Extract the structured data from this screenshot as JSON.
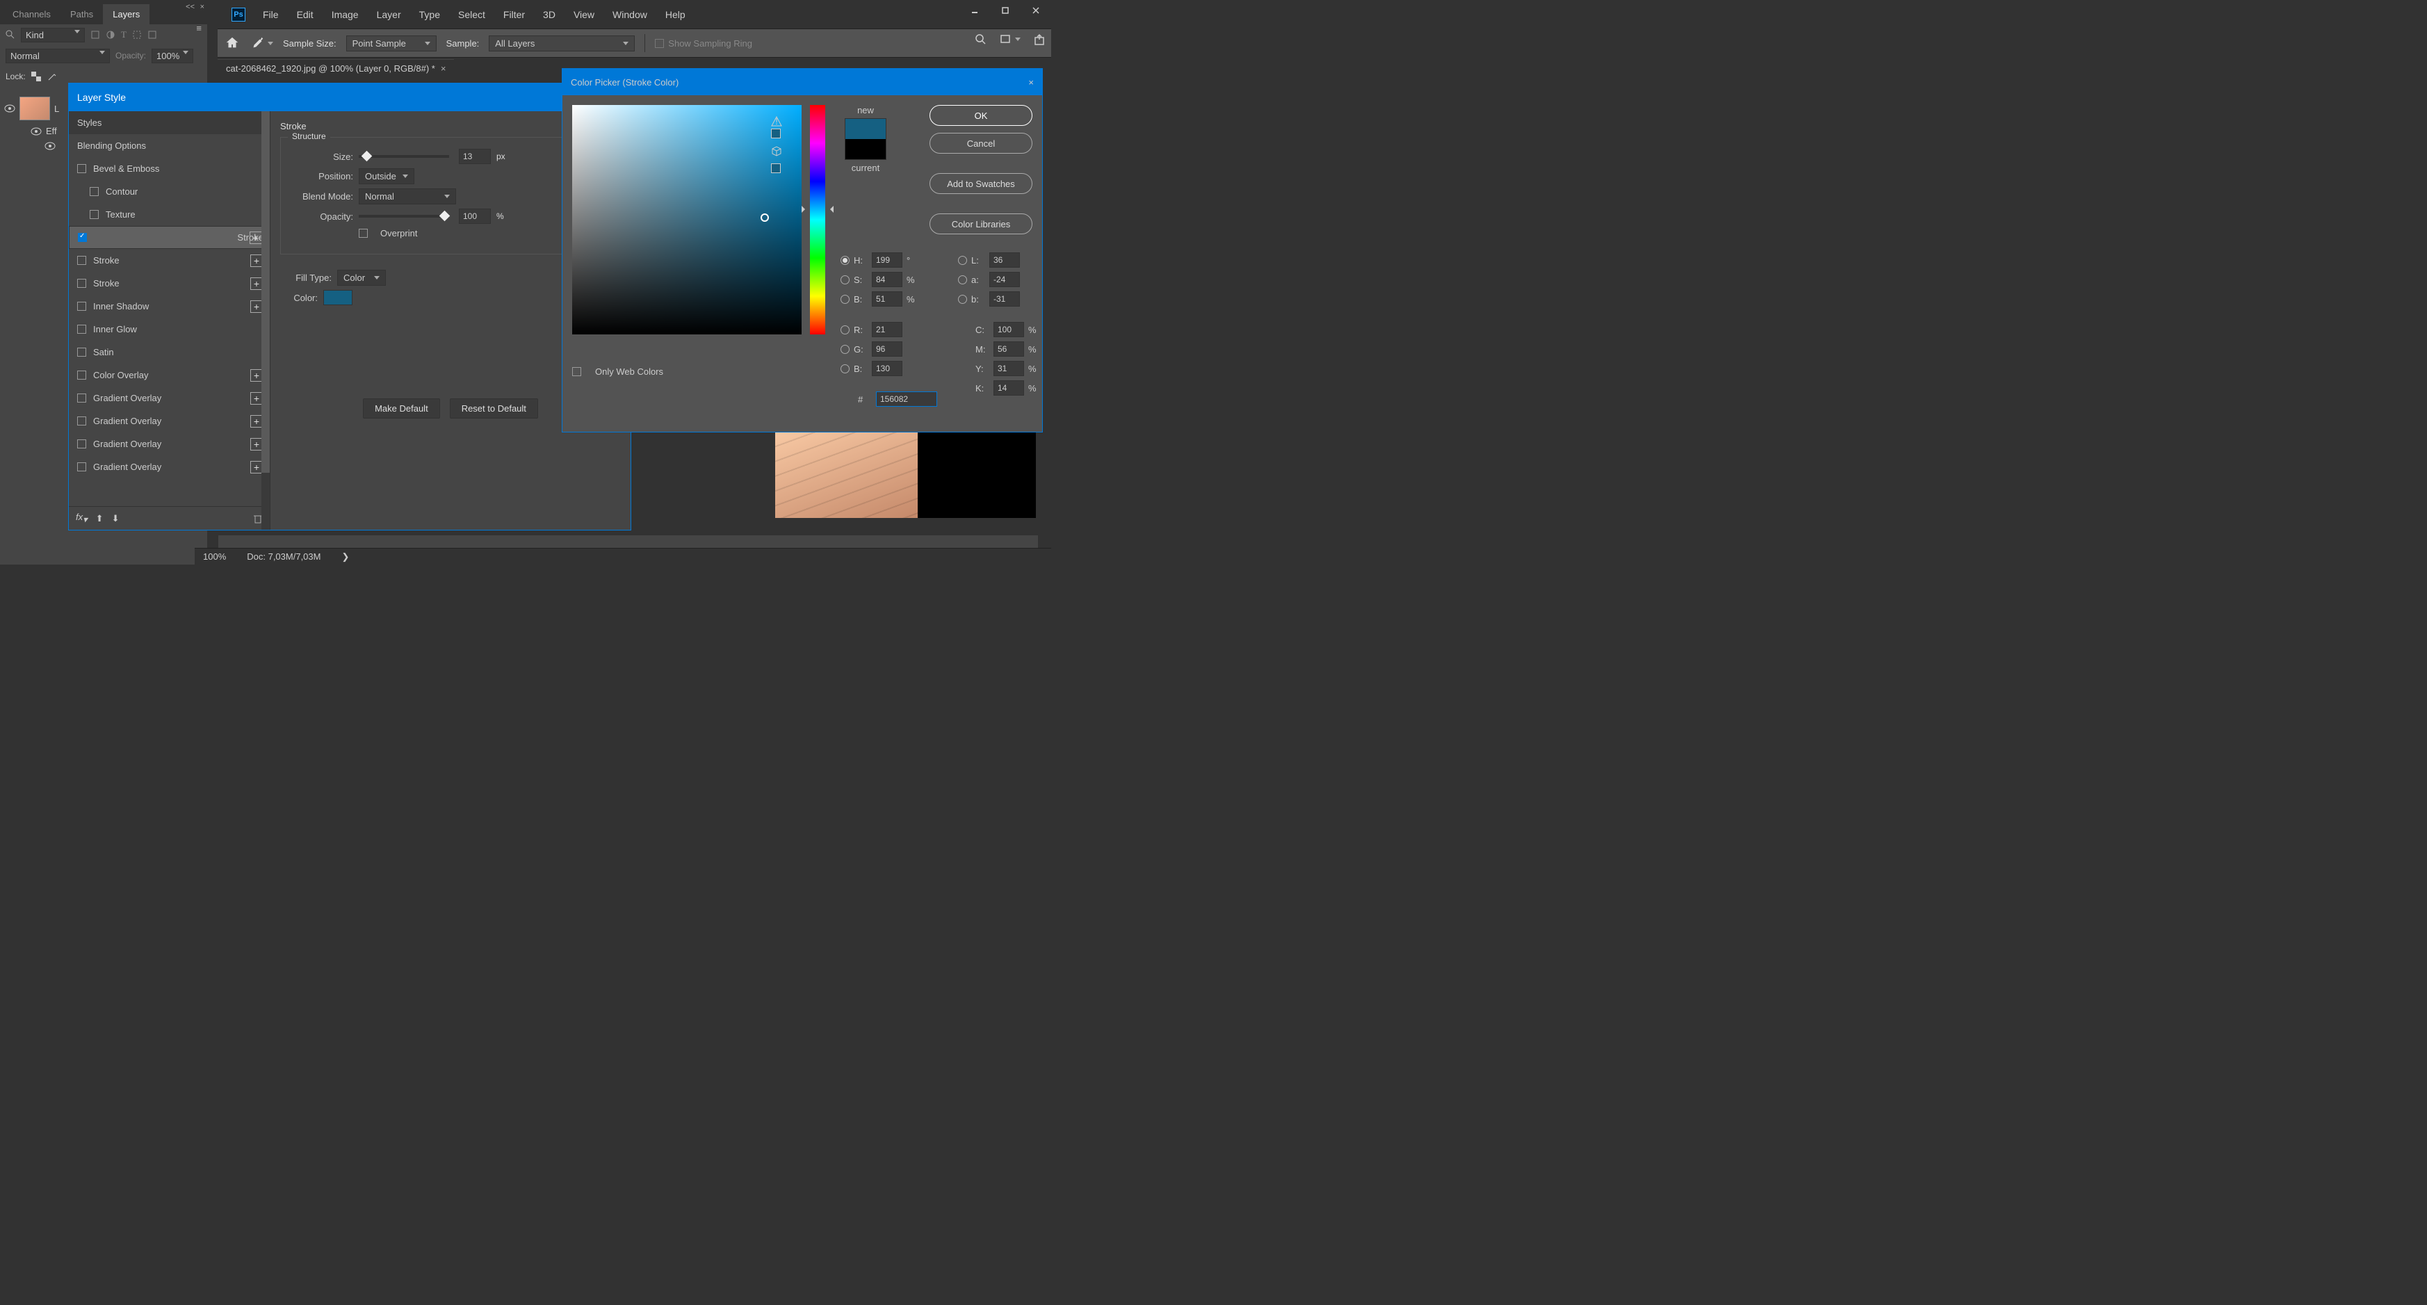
{
  "app": {
    "name": "Ps"
  },
  "menu": [
    "File",
    "Edit",
    "Image",
    "Layer",
    "Type",
    "Select",
    "Filter",
    "3D",
    "View",
    "Window",
    "Help"
  ],
  "toolbar": {
    "sample_size_label": "Sample Size:",
    "sample_size_value": "Point Sample",
    "sample_label": "Sample:",
    "sample_value": "All Layers",
    "show_ring": "Show Sampling Ring"
  },
  "document": {
    "tab": "cat-2068462_1920.jpg @ 100% (Layer 0, RGB/8#) *"
  },
  "panels": {
    "tabs": [
      "Channels",
      "Paths",
      "Layers"
    ],
    "kind_filter": "Kind",
    "blend_mode": "Normal",
    "opacity_label": "Opacity:",
    "opacity_value": "100%",
    "lock_label": "Lock:",
    "layer0": "L",
    "effects": "Eff",
    "sub": ""
  },
  "layerstyle": {
    "title": "Layer Style",
    "styles": "Styles",
    "blending": "Blending Options",
    "rows": [
      {
        "label": "Bevel & Emboss",
        "chk": false,
        "plus": false,
        "indent": 0
      },
      {
        "label": "Contour",
        "chk": false,
        "plus": false,
        "indent": 1
      },
      {
        "label": "Texture",
        "chk": false,
        "plus": false,
        "indent": 1
      },
      {
        "label": "Stroke",
        "chk": true,
        "plus": true,
        "indent": 0,
        "sel": true
      },
      {
        "label": "Stroke",
        "chk": false,
        "plus": true,
        "indent": 0
      },
      {
        "label": "Stroke",
        "chk": false,
        "plus": true,
        "indent": 0
      },
      {
        "label": "Inner Shadow",
        "chk": false,
        "plus": true,
        "indent": 0
      },
      {
        "label": "Inner Glow",
        "chk": false,
        "plus": false,
        "indent": 0
      },
      {
        "label": "Satin",
        "chk": false,
        "plus": false,
        "indent": 0
      },
      {
        "label": "Color Overlay",
        "chk": false,
        "plus": true,
        "indent": 0
      },
      {
        "label": "Gradient Overlay",
        "chk": false,
        "plus": true,
        "indent": 0
      },
      {
        "label": "Gradient Overlay",
        "chk": false,
        "plus": true,
        "indent": 0
      },
      {
        "label": "Gradient Overlay",
        "chk": false,
        "plus": true,
        "indent": 0
      },
      {
        "label": "Gradient Overlay",
        "chk": false,
        "plus": true,
        "indent": 0
      }
    ],
    "section": "Stroke",
    "structure": "Structure",
    "size_label": "Size:",
    "size_value": "13",
    "px": "px",
    "position_label": "Position:",
    "position_value": "Outside",
    "blendmode_label": "Blend Mode:",
    "blendmode_value": "Normal",
    "opacity_label": "Opacity:",
    "opacity_value": "100",
    "pct": "%",
    "overprint": "Overprint",
    "filltype_label": "Fill Type:",
    "filltype_value": "Color",
    "color_label": "Color:",
    "color_swatch": "#156082",
    "make_default": "Make Default",
    "reset_default": "Reset to Default"
  },
  "colorpicker": {
    "title": "Color Picker (Stroke Color)",
    "ok": "OK",
    "cancel": "Cancel",
    "add_swatch": "Add to Swatches",
    "libraries": "Color Libraries",
    "new": "new",
    "current": "current",
    "new_color": "#156082",
    "current_color": "#000000",
    "web_only": "Only Web Colors",
    "H": "199",
    "S": "84",
    "B": "51",
    "R": "21",
    "G": "96",
    "Bb": "130",
    "L": "36",
    "a": "-24",
    "b": "-31",
    "C": "100",
    "M": "56",
    "Y": "31",
    "K": "14",
    "hex": "156082",
    "deg": "°",
    "pct": "%",
    "hash": "#",
    "labels": {
      "H": "H:",
      "S": "S:",
      "B": "B:",
      "L": "L:",
      "a": "a:",
      "b": "b:",
      "R": "R:",
      "G": "G:",
      "Bb": "B:",
      "C": "C:",
      "M": "M:",
      "Y": "Y:",
      "K": "K:"
    }
  },
  "status": {
    "zoom": "100%",
    "doc": "Doc: 7,03M/7,03M"
  }
}
